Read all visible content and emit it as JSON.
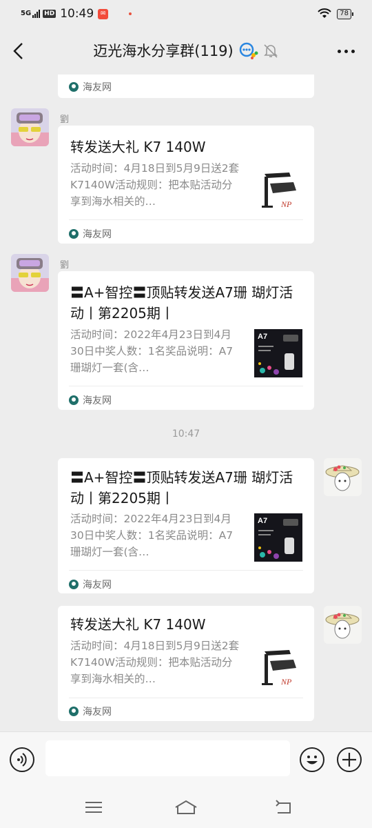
{
  "status_bar": {
    "network": "5G",
    "hd_badge": "HD",
    "time": "10:49",
    "notification_icon": "app-notification-icon",
    "battery": "78"
  },
  "header": {
    "title": "迈光海水分享群(119)"
  },
  "chat": {
    "timestamp": "10:47",
    "partial_card": {
      "source": "海友网"
    },
    "messages": [
      {
        "sender": "劉",
        "title": "转发送大礼 K7 140W",
        "desc": "活动时间：4月18日到5月9日送2套K7140W活动规则：把本贴活动分享到海水相关的…",
        "source": "海友网",
        "thumb": "k7-lamp-thumbnail"
      },
      {
        "sender": "劉",
        "title": "〓A+智控〓顶贴转发送A7珊 瑚灯活动丨第2205期丨",
        "desc": "活动时间：2022年4月23日到4月30日中奖人数：1名奖品说明：A7珊瑚灯一套(含…",
        "source": "海友网",
        "thumb": "a7-lamp-thumbnail",
        "thumb_label": "A7"
      },
      {
        "sender": "",
        "title": "〓A+智控〓顶贴转发送A7珊 瑚灯活动丨第2205期丨",
        "desc": "活动时间：2022年4月23日到4月30日中奖人数：1名奖品说明：A7珊瑚灯一套(含…",
        "source": "海友网",
        "thumb": "a7-lamp-thumbnail",
        "thumb_label": "A7"
      },
      {
        "sender": "",
        "title": "转发送大礼 K7 140W",
        "desc": "活动时间：4月18日到5月9日送2套K7140W活动规则：把本贴活动分享到海水相关的…",
        "source": "海友网",
        "thumb": "k7-lamp-thumbnail"
      }
    ]
  },
  "input_bar": {
    "value": "",
    "voice_icon": "voice-icon",
    "emoji_icon": "emoji-icon",
    "add_icon": "add-icon"
  },
  "colors": {
    "background": "#ededed",
    "card": "#ffffff",
    "source_icon": "#1f6f6a",
    "muted_text": "#8a8a8a"
  }
}
